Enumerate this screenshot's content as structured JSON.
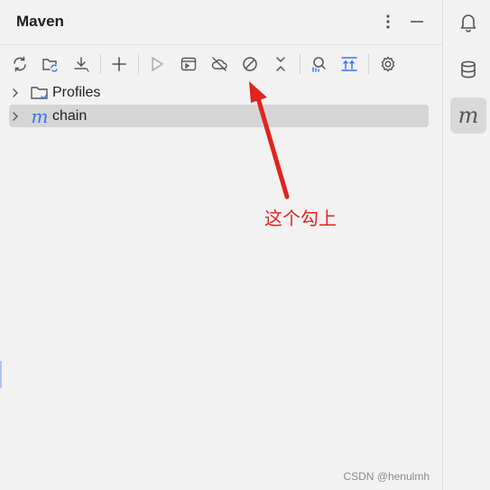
{
  "panel": {
    "title": "Maven",
    "more_icon": "vertical-dots-icon",
    "minimize_icon": "minimize-icon"
  },
  "toolbar": {
    "buttons": [
      {
        "name": "reload-all-projects-button",
        "icon": "sync-icon"
      },
      {
        "name": "generate-sources-button",
        "icon": "folder-sync-icon"
      },
      {
        "name": "download-sources-button",
        "icon": "download-icon"
      },
      {
        "name": "add-maven-project-button",
        "icon": "plus-icon"
      },
      {
        "name": "run-maven-build-button",
        "icon": "run-icon"
      },
      {
        "name": "execute-goal-button",
        "icon": "terminal-icon"
      },
      {
        "name": "toggle-offline-mode-button",
        "icon": "cloud-off-icon"
      },
      {
        "name": "skip-tests-button",
        "icon": "prohibited-icon"
      },
      {
        "name": "collapse-all-button",
        "icon": "collapse-icon"
      },
      {
        "name": "analyze-dependencies-button",
        "icon": "analyze-icon"
      },
      {
        "name": "show-dependencies-button",
        "icon": "dependencies-icon"
      },
      {
        "name": "settings-button",
        "icon": "gear-icon"
      }
    ]
  },
  "tree": {
    "items": [
      {
        "label": "Profiles",
        "icon": "folder-check-icon",
        "selected": false
      },
      {
        "label": "chain",
        "icon": "maven-m-icon",
        "selected": true
      }
    ]
  },
  "sidebar": {
    "items": [
      {
        "name": "notifications",
        "icon": "bell-icon",
        "active": false
      },
      {
        "name": "database",
        "icon": "database-icon",
        "active": false
      },
      {
        "name": "maven",
        "icon": "maven-m-icon",
        "active": true,
        "glyph": "m"
      }
    ]
  },
  "annotation": {
    "text": "这个勾上",
    "color": "#e0241e"
  },
  "watermark": "CSDN @henulmh",
  "colors": {
    "accent": "#3574f0",
    "selection": "#d5d5d5",
    "background": "#f2f2f2"
  }
}
